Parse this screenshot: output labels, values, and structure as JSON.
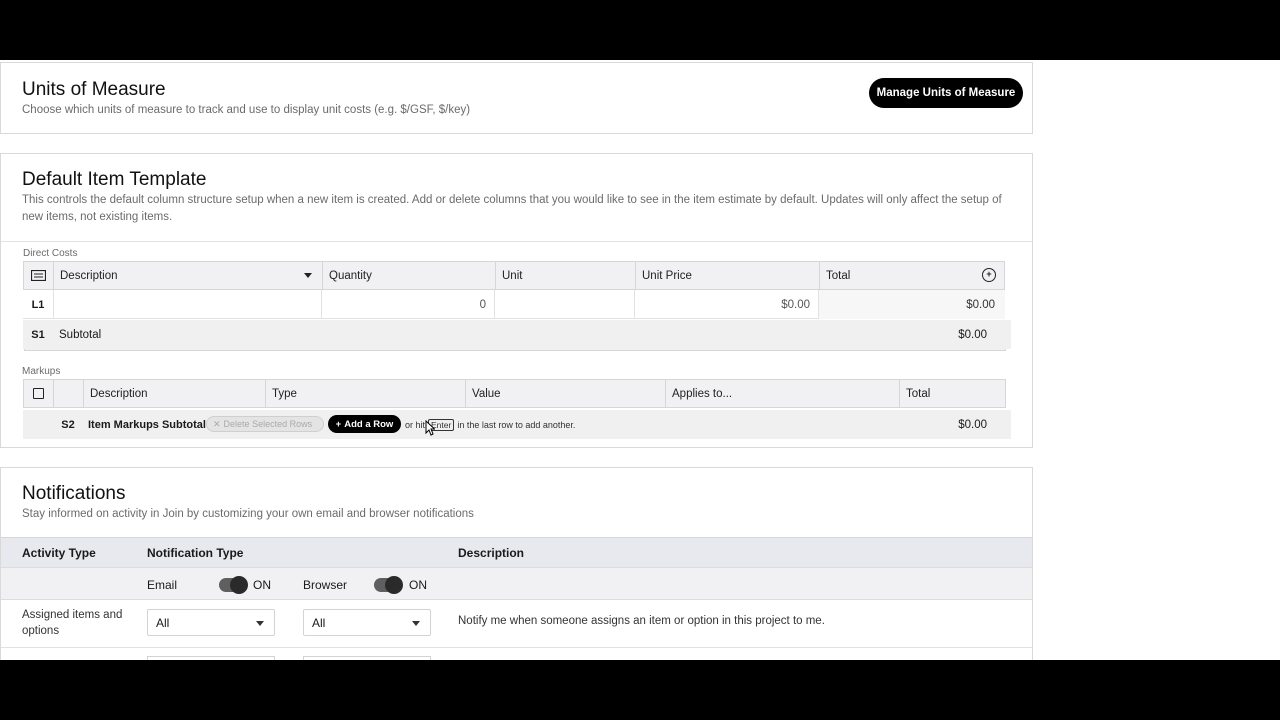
{
  "units": {
    "title": "Units of Measure",
    "subtitle": "Choose which units of measure to track and use to display unit costs (e.g. $/GSF, $/key)",
    "manage_button": "Manage Units of Measure"
  },
  "template": {
    "title": "Default Item Template",
    "description": "This controls the default column structure setup when a new item is created. Add or delete columns that you would like to see in the item estimate by default. Updates will only affect the setup of new items, not existing items.",
    "direct_costs_label": "Direct Costs",
    "direct_headers": [
      "Description",
      "Quantity",
      "Unit",
      "Unit Price",
      "Total"
    ],
    "line_item": {
      "code": "L1",
      "description": "",
      "quantity": "0",
      "unit": "",
      "unit_price": "$0.00",
      "total": "$0.00"
    },
    "subtotal": {
      "code": "S1",
      "label": "Subtotal",
      "total": "$0.00"
    },
    "markups_label": "Markups",
    "markup_headers": [
      "Description",
      "Type",
      "Value",
      "Applies to...",
      "Total"
    ],
    "markup_subtotal": {
      "code": "S2",
      "label": "Item Markups Subtotal",
      "delete_label": "Delete Selected Rows",
      "add_label": "Add a Row",
      "hint_before": "or hit",
      "hint_key": "Enter",
      "hint_after": "in the last row to add another.",
      "total": "$0.00"
    }
  },
  "notifications": {
    "title": "Notifications",
    "subtitle": "Stay informed on activity in Join by customizing your own email and browser notifications",
    "headers": {
      "activity": "Activity Type",
      "type": "Notification Type",
      "description": "Description"
    },
    "email_label": "Email",
    "email_state": "ON",
    "browser_label": "Browser",
    "browser_state": "ON",
    "rows": [
      {
        "activity": "Assigned items and options",
        "email": "All",
        "browser": "All",
        "description": "Notify me when someone assigns an item or option in this project to me."
      }
    ]
  },
  "colors": {
    "accent": "#000000",
    "header_bg": "#f1f1f4",
    "subtotal_bg": "#f0f0f0",
    "notif_header_bg": "#e8e8ef"
  }
}
